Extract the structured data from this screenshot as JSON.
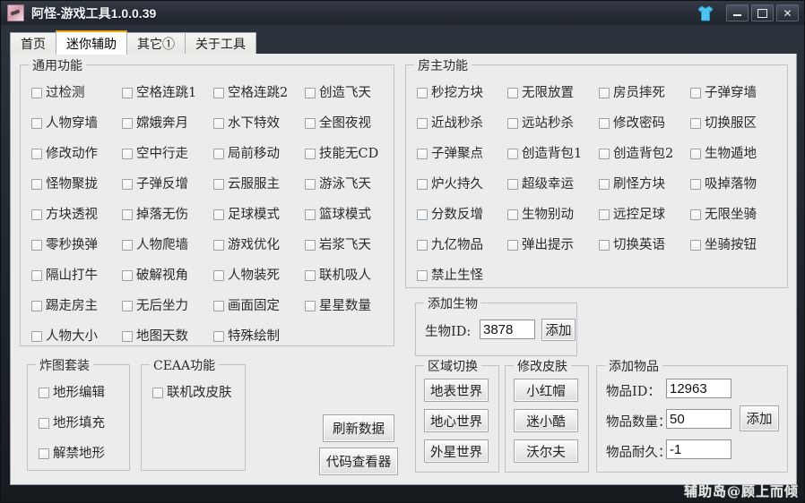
{
  "window": {
    "title": "阿怪-游戏工具1.0.0.39",
    "app_icon": "app-logo-icon",
    "shirt_icon": "shirt-icon",
    "buttons": {
      "minimize": "minimize-button",
      "maximize": "maximize-button",
      "close": "close-button"
    }
  },
  "tabs": [
    {
      "label": "首页",
      "active": false
    },
    {
      "label": "迷你辅助",
      "active": true
    },
    {
      "label": "其它①",
      "active": false
    },
    {
      "label": "关于工具",
      "active": false
    }
  ],
  "groups": {
    "general": {
      "title": "通用功能",
      "items": [
        "过检测",
        "空格连跳1",
        "空格连跳2",
        "创造飞天",
        "人物穿墙",
        "嫦娥奔月",
        "水下特效",
        "全图夜视",
        "修改动作",
        "空中行走",
        "局前移动",
        "技能无CD",
        "怪物聚拢",
        "子弹反增",
        "云服服主",
        "游泳飞天",
        "方块透视",
        "掉落无伤",
        "足球模式",
        "篮球模式",
        "零秒换弹",
        "人物爬墙",
        "游戏优化",
        "岩浆飞天",
        "隔山打牛",
        "破解视角",
        "人物装死",
        "联机吸人",
        "踢走房主",
        "无后坐力",
        "画面固定",
        "星星数量",
        "人物大小",
        "地图天数",
        "特殊绘制"
      ]
    },
    "host": {
      "title": "房主功能",
      "items": [
        "秒挖方块",
        "无限放置",
        "房员摔死",
        "子弹穿墙",
        "近战秒杀",
        "远站秒杀",
        "修改密码",
        "切换服区",
        "子弹聚点",
        "创造背包1",
        "创造背包2",
        "生物遁地",
        "炉火持久",
        "超级幸运",
        "刷怪方块",
        "吸掉落物",
        "分数反增",
        "生物别动",
        "远控足球",
        "无限坐骑",
        "九亿物品",
        "弹出提示",
        "切换英语",
        "坐骑按钮",
        "禁止生怪"
      ]
    },
    "bomb_map": {
      "title": "炸图套装",
      "items": [
        "地形编辑",
        "地形填充",
        "解禁地形"
      ]
    },
    "ceaa": {
      "title": "CEAA功能",
      "items": [
        "联机改皮肤"
      ]
    },
    "add_creature": {
      "title": "添加生物",
      "id_label": "生物ID:",
      "id_value": "3878",
      "add_button": "添加"
    },
    "region_switch": {
      "title": "区域切换",
      "buttons": [
        "地表世界",
        "地心世界",
        "外星世界"
      ]
    },
    "skin_change": {
      "title": "修改皮肤",
      "buttons": [
        "小红帽",
        "迷小酷",
        "沃尔夫"
      ]
    },
    "add_item": {
      "title": "添加物品",
      "fields": [
        {
          "label": "物品ID：",
          "value": "12963"
        },
        {
          "label": "物品数量：",
          "value": "50"
        },
        {
          "label": "物品耐久：",
          "value": "-1"
        }
      ],
      "add_button": "添加"
    }
  },
  "actions": {
    "refresh_data": "刷新数据",
    "code_viewer": "代码查看器"
  },
  "watermark": "辅助岛@顾上而倾",
  "colors": {
    "accent": "#f0a30a",
    "titlebar": "#2b313a",
    "panel": "#ececed"
  }
}
